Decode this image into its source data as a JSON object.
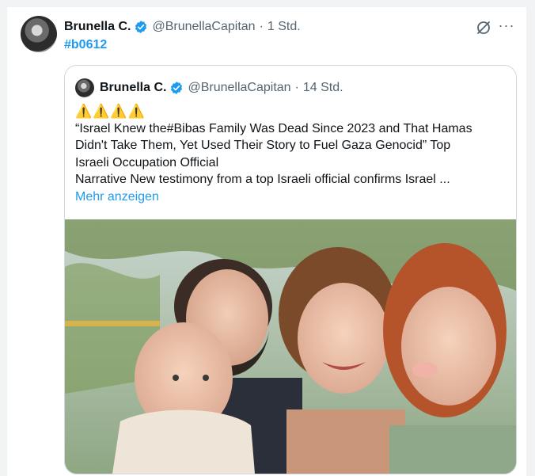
{
  "tweet": {
    "name": "Brunella C.",
    "handle": "@BrunellaCapitan",
    "separator": "·",
    "time": "1 Std.",
    "hashtag": "#b0612",
    "more_label": "···"
  },
  "quoted": {
    "name": "Brunella C.",
    "handle": "@BrunellaCapitan",
    "separator": "·",
    "time": "14 Std.",
    "warning_icons": "⚠️⚠️⚠️⚠️",
    "lines": [
      "“Israel Knew the#Bibas Family Was Dead Since 2023 and That Hamas",
      "Didn't Take Them, Yet Used Their Story to Fuel Gaza Genocid” Top",
      "Israeli Occupation Official",
      "Narrative New testimony from a top Israeli official confirms Israel ..."
    ],
    "show_more": "Mehr anzeigen"
  },
  "colors": {
    "accent": "#1d9bf0",
    "secondary_text": "#536471",
    "border": "#cfd9de"
  },
  "icons": {
    "verified": "verified-badge-icon",
    "grok": "grok-icon",
    "more": "more-options-icon",
    "warning": "warning-icon"
  }
}
